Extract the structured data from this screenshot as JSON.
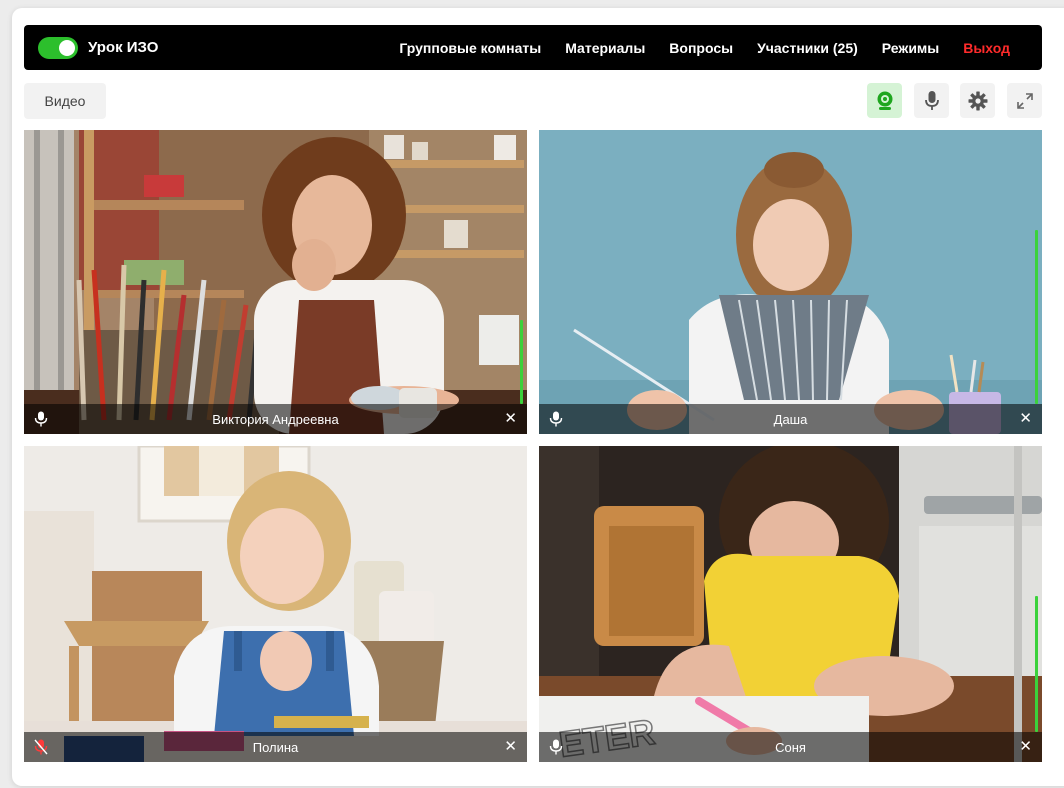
{
  "header": {
    "lesson_title": "Урок ИЗО",
    "nav": {
      "rooms": "Групповые комнаты",
      "materials": "Материалы",
      "questions": "Вопросы",
      "participants": "Участники (25)",
      "modes": "Режимы",
      "exit": "Выход"
    }
  },
  "toolbar": {
    "video_label": "Видео",
    "icons": [
      "webcam-icon",
      "microphone-icon",
      "gear-icon",
      "fullscreen-icon"
    ]
  },
  "participants": [
    {
      "name": "Виктория Андреевна",
      "mic": "on",
      "audio_level": 0.25
    },
    {
      "name": "Даша",
      "mic": "on",
      "audio_level": 0.55
    },
    {
      "name": "Полина",
      "mic": "muted",
      "audio_level": 0.0
    },
    {
      "name": "Соня",
      "mic": "on",
      "audio_level": 0.45
    }
  ],
  "colors": {
    "accent_green": "#2cbf2c",
    "exit_red": "#ff2b2b",
    "muted_red": "#ff3b3b",
    "topbar_bg": "#000000"
  }
}
